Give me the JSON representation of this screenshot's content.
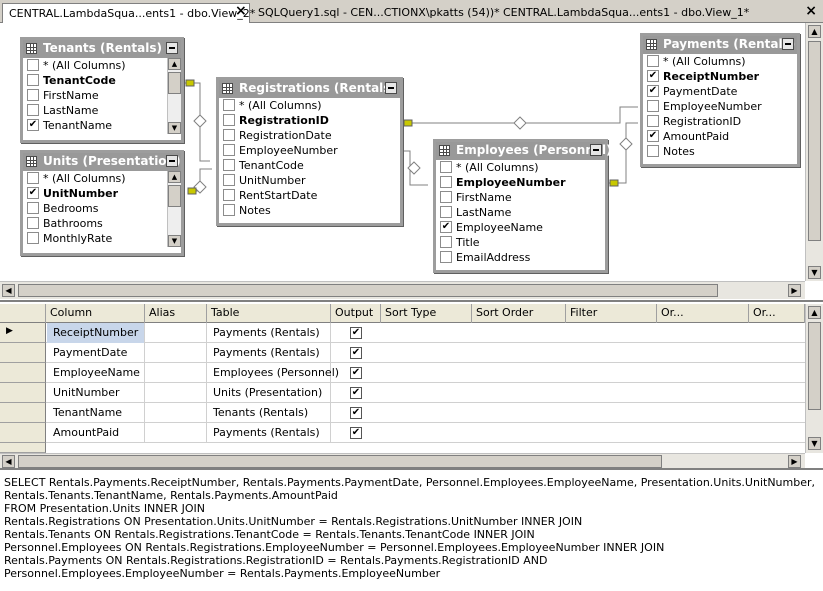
{
  "tabs": [
    {
      "label": "CENTRAL.LambdaSqua...ents1 - dbo.View_2*",
      "active": true
    },
    {
      "label": "SQLQuery1.sql - CEN...CTIONX\\pkatts (54))*",
      "active": false
    },
    {
      "label": "CENTRAL.LambdaSqua...ents1 - dbo.View_1*",
      "active": false
    }
  ],
  "tab_close_glyph": "×",
  "window_close_glyph": "×",
  "diagram": {
    "tables": [
      {
        "title": "Tenants (Rentals)",
        "rows": [
          {
            "label": "* (All Columns)",
            "checked": false,
            "key": false
          },
          {
            "label": "TenantCode",
            "checked": false,
            "key": true
          },
          {
            "label": "FirstName",
            "checked": false,
            "key": false
          },
          {
            "label": "LastName",
            "checked": false,
            "key": false
          },
          {
            "label": "TenantName",
            "checked": true,
            "key": false
          }
        ]
      },
      {
        "title": "Units (Presentation)",
        "rows": [
          {
            "label": "* (All Columns)",
            "checked": false,
            "key": false
          },
          {
            "label": "UnitNumber",
            "checked": true,
            "key": true
          },
          {
            "label": "Bedrooms",
            "checked": false,
            "key": false
          },
          {
            "label": "Bathrooms",
            "checked": false,
            "key": false
          },
          {
            "label": "MonthlyRate",
            "checked": false,
            "key": false
          }
        ]
      },
      {
        "title": "Registrations (Rentals)",
        "rows": [
          {
            "label": "* (All Columns)",
            "checked": false,
            "key": false
          },
          {
            "label": "RegistrationID",
            "checked": false,
            "key": true
          },
          {
            "label": "RegistrationDate",
            "checked": false,
            "key": false
          },
          {
            "label": "EmployeeNumber",
            "checked": false,
            "key": false
          },
          {
            "label": "TenantCode",
            "checked": false,
            "key": false
          },
          {
            "label": "UnitNumber",
            "checked": false,
            "key": false
          },
          {
            "label": "RentStartDate",
            "checked": false,
            "key": false
          },
          {
            "label": "Notes",
            "checked": false,
            "key": false
          }
        ]
      },
      {
        "title": "Employees (Personnel)",
        "rows": [
          {
            "label": "* (All Columns)",
            "checked": false,
            "key": false
          },
          {
            "label": "EmployeeNumber",
            "checked": false,
            "key": true
          },
          {
            "label": "FirstName",
            "checked": false,
            "key": false
          },
          {
            "label": "LastName",
            "checked": false,
            "key": false
          },
          {
            "label": "EmployeeName",
            "checked": true,
            "key": false
          },
          {
            "label": "Title",
            "checked": false,
            "key": false
          },
          {
            "label": "EmailAddress",
            "checked": false,
            "key": false
          }
        ]
      },
      {
        "title": "Payments (Rentals)",
        "rows": [
          {
            "label": "* (All Columns)",
            "checked": false,
            "key": false
          },
          {
            "label": "ReceiptNumber",
            "checked": true,
            "key": true
          },
          {
            "label": "PaymentDate",
            "checked": true,
            "key": false
          },
          {
            "label": "EmployeeNumber",
            "checked": false,
            "key": false
          },
          {
            "label": "RegistrationID",
            "checked": false,
            "key": false
          },
          {
            "label": "AmountPaid",
            "checked": true,
            "key": false
          },
          {
            "label": "Notes",
            "checked": false,
            "key": false
          }
        ]
      }
    ]
  },
  "grid": {
    "headers": [
      "Column",
      "Alias",
      "Table",
      "Output",
      "Sort Type",
      "Sort Order",
      "Filter",
      "Or...",
      "Or..."
    ],
    "rows": [
      {
        "column": "ReceiptNumber",
        "alias": "",
        "table": "Payments (Rentals)",
        "output": true
      },
      {
        "column": "PaymentDate",
        "alias": "",
        "table": "Payments (Rentals)",
        "output": true
      },
      {
        "column": "EmployeeName",
        "alias": "",
        "table": "Employees (Personnel)",
        "output": true
      },
      {
        "column": "UnitNumber",
        "alias": "",
        "table": "Units (Presentation)",
        "output": true
      },
      {
        "column": "TenantName",
        "alias": "",
        "table": "Tenants (Rentals)",
        "output": true
      },
      {
        "column": "AmountPaid",
        "alias": "",
        "table": "Payments (Rentals)",
        "output": true
      }
    ],
    "row_indicator": "▶",
    "check_glyph": "✔"
  },
  "sql": {
    "lines": [
      "SELECT     Rentals.Payments.ReceiptNumber, Rentals.Payments.PaymentDate, Personnel.Employees.EmployeeName, Presentation.Units.UnitNumber,",
      "                Rentals.Tenants.TenantName, Rentals.Payments.AmountPaid",
      "FROM        Presentation.Units INNER JOIN",
      "                Rentals.Registrations ON Presentation.Units.UnitNumber = Rentals.Registrations.UnitNumber INNER JOIN",
      "                Rentals.Tenants ON Rentals.Registrations.TenantCode = Rentals.Tenants.TenantCode INNER JOIN",
      "                Personnel.Employees ON Rentals.Registrations.EmployeeNumber = Personnel.Employees.EmployeeNumber INNER JOIN",
      "                Rentals.Payments ON Rentals.Registrations.RegistrationID = Rentals.Payments.RegistrationID AND",
      "                Personnel.Employees.EmployeeNumber = Rentals.Payments.EmployeeNumber"
    ]
  },
  "colors": {
    "header_gray": "#999999",
    "selected_cell": "#c8d6ea",
    "relation_line": "#808080",
    "key_end": "#c8c800"
  },
  "scroll_glyphs": {
    "up": "▲",
    "down": "▼",
    "left": "◀",
    "right": "▶"
  }
}
